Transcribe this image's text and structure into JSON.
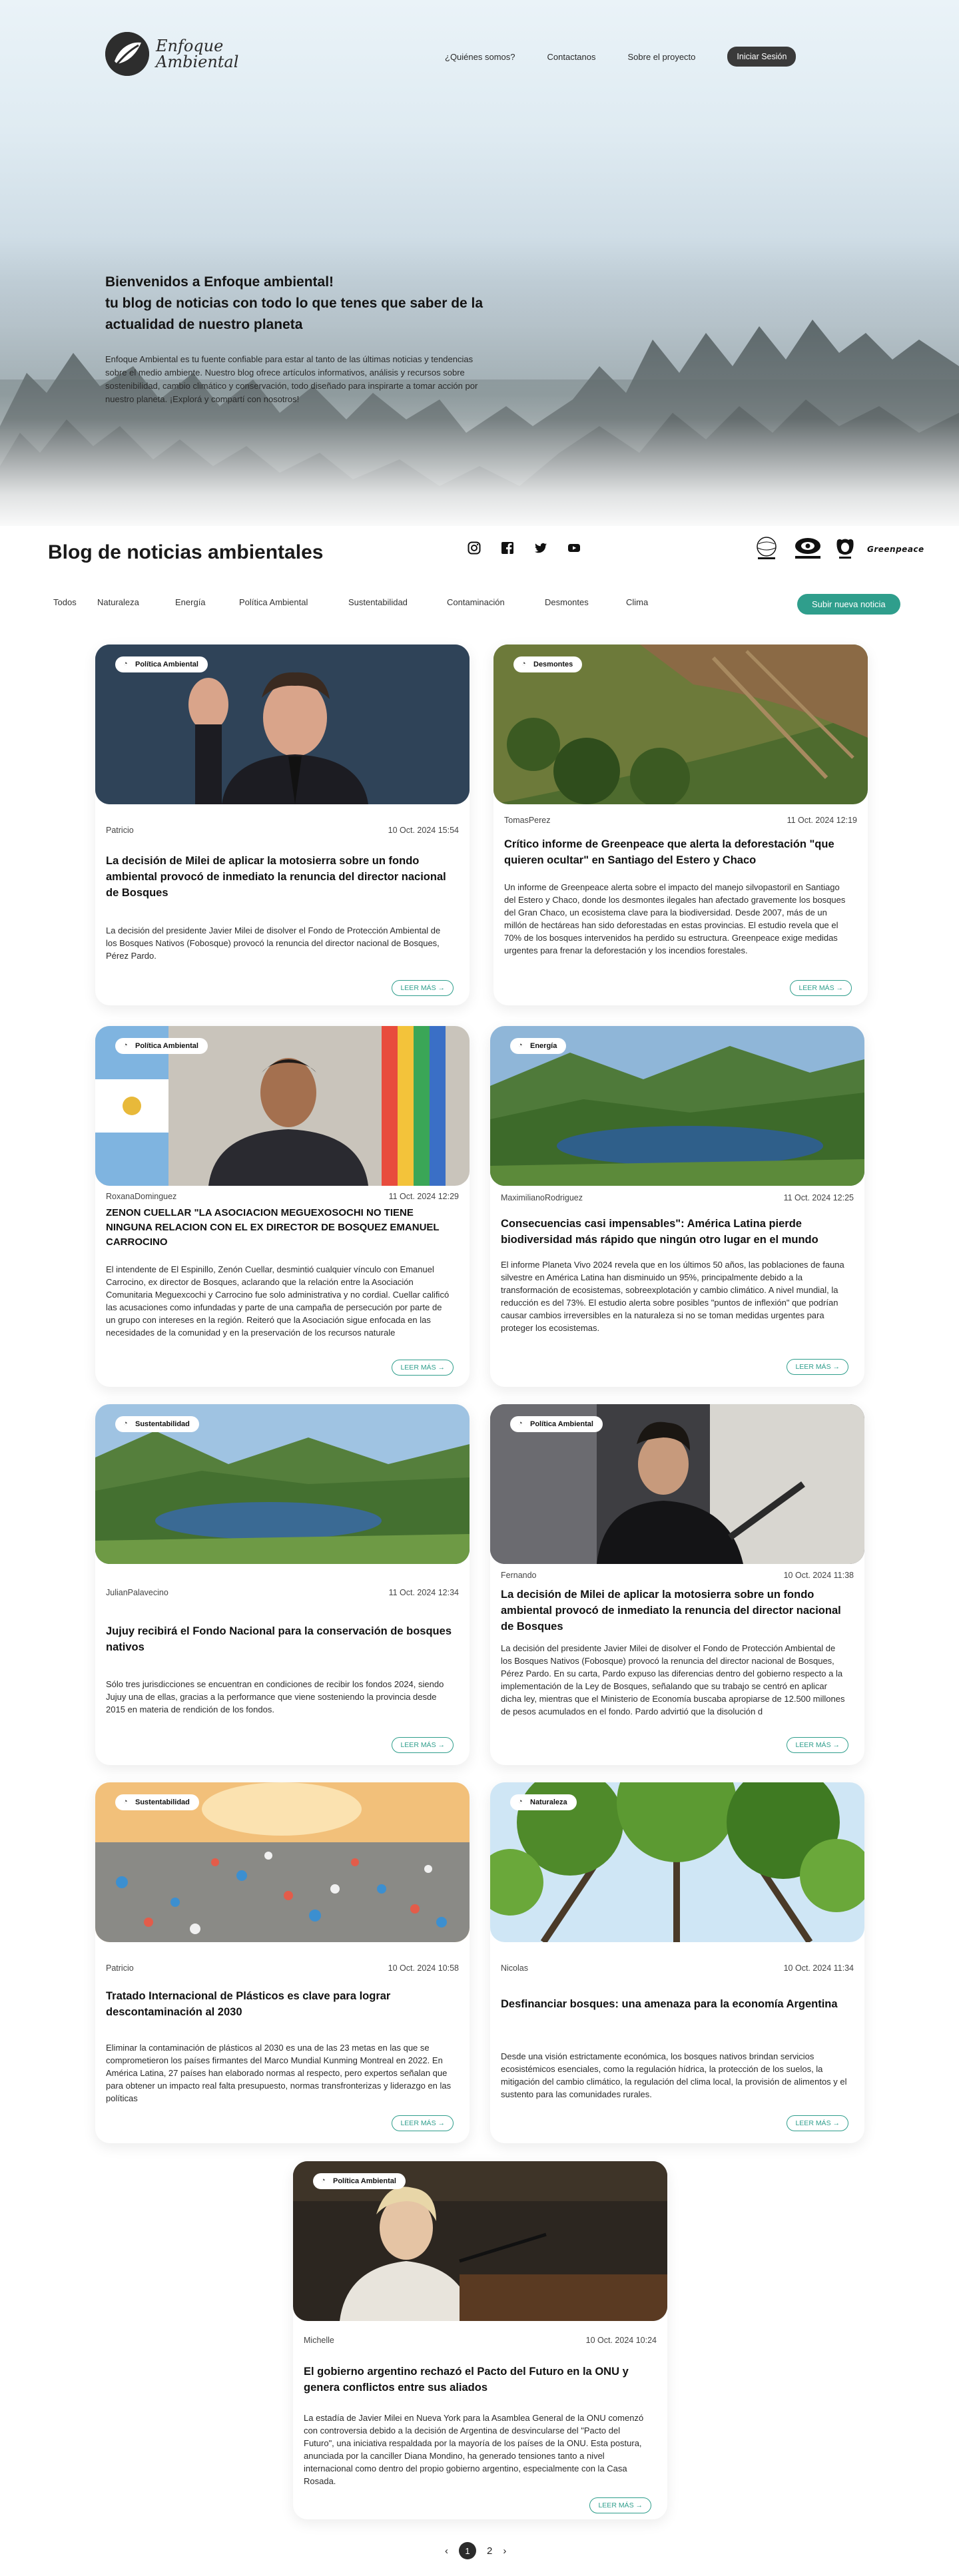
{
  "header": {
    "brand_line1": "Enfoque",
    "brand_line2": "Ambiental",
    "nav": [
      "¿Quiénes somos?",
      "Contactanos",
      "Sobre el proyecto"
    ],
    "login_label": "Iniciar Sesión"
  },
  "hero": {
    "title_line1": "Bienvenidos a Enfoque ambiental!",
    "title_line2": "tu blog de noticias con todo lo que tenes que saber de la actualidad de nuestro planeta",
    "description": "Enfoque Ambiental es tu fuente confiable para estar al tanto de las últimas noticias y tendencias sobre el medio ambiente. Nuestro blog ofrece artículos informativos, análisis y recursos sobre sostenibilidad, cambio climático y conservación, todo diseñado para inspirarte a tomar acción por nuestro planeta. ¡Explorá y compartí con nosotros!"
  },
  "blog": {
    "title": "Blog de noticias ambientales",
    "social_icons": [
      "instagram-icon",
      "facebook-icon",
      "twitter-icon",
      "youtube-icon"
    ],
    "partners": [
      "Fundación Vida Silvestre",
      "Greenpeace"
    ],
    "filters": [
      "Todos",
      "Naturaleza",
      "Energía",
      "Política Ambiental",
      "Sustentabilidad",
      "Contaminación",
      "Desmontes",
      "Clima"
    ],
    "submit_label": "Subir nueva noticia"
  },
  "colors": {
    "accent": "#2f9e8c",
    "dark": "#2b2b2b"
  },
  "posts": [
    {
      "category": "Política Ambiental",
      "author": "Patricio",
      "date": "10 Oct. 2024 15:54",
      "title": "La decisión de Milei de aplicar la motosierra sobre un fondo ambiental provocó de inmediato la renuncia del director nacional de Bosques",
      "body": "La decisión del presidente Javier Milei de disolver el Fondo de Protección Ambiental de los Bosques Nativos (Fobosque) provocó la renuncia del director nacional de Bosques, Pérez Pardo.",
      "more": "LEER MÁS →"
    },
    {
      "category": "Desmontes",
      "author": "TomasPerez",
      "date": "11 Oct. 2024 12:19",
      "title": "Crítico informe de Greenpeace que alerta la deforestación \"que quieren ocultar\" en Santiago del Estero y Chaco",
      "body": "Un informe de Greenpeace alerta sobre el impacto del manejo silvopastoril en Santiago del Estero y Chaco, donde los desmontes ilegales han afectado gravemente los bosques del Gran Chaco, un ecosistema clave para la biodiversidad. Desde 2007, más de un millón de hectáreas han sido deforestadas en estas provincias. El estudio revela que el 70% de los bosques intervenidos ha perdido su estructura. Greenpeace exige medidas urgentes para frenar la deforestación y los incendios forestales.",
      "more": "LEER MÁS →"
    },
    {
      "category": "Política Ambiental",
      "author": "RoxanaDominguez",
      "date": "11 Oct. 2024 12:29",
      "title": "ZENON CUELLAR \"LA ASOCIACION MEGUEXOSOCHI NO TIENE NINGUNA RELACION CON EL EX DIRECTOR DE BOSQUEZ EMANUEL CARROCINO",
      "body": "El intendente de El Espinillo, Zenón Cuellar, desmintió cualquier vínculo con Emanuel Carrocino, ex director de Bosques, aclarando que la relación entre la Asociación Comunitaria Meguexcochi y Carrocino fue solo administrativa y no cordial. Cuellar calificó las acusaciones como infundadas y parte de una campaña de persecución por parte de un grupo con intereses en la región. Reiteró que la Asociación sigue enfocada en las necesidades de la comunidad y en la preservación de los recursos naturale",
      "more": "LEER MÁS →"
    },
    {
      "category": "Energía",
      "author": "MaximilianoRodriguez",
      "date": "11 Oct. 2024 12:25",
      "title": "Consecuencias casi impensables\": América Latina pierde biodiversidad más rápido que ningún otro lugar en el mundo",
      "body": "El informe Planeta Vivo 2024 revela que en los últimos 50 años, las poblaciones de fauna silvestre en América Latina han disminuido un 95%, principalmente debido a la transformación de ecosistemas, sobreexplotación y cambio climático. A nivel mundial, la reducción es del 73%. El estudio alerta sobre posibles \"puntos de inflexión\" que podrían causar cambios irreversibles en la naturaleza si no se toman medidas urgentes para proteger los ecosistemas.",
      "more": "LEER MÁS →"
    },
    {
      "category": "Sustentabilidad",
      "author": "JulianPalavecino",
      "date": "11 Oct. 2024 12:34",
      "title": "Jujuy recibirá el Fondo Nacional para la conservación de bosques nativos",
      "body": "Sólo tres jurisdicciones se encuentran en condiciones de recibir los fondos 2024, siendo Jujuy una de ellas, gracias a la performance que viene sosteniendo la provincia desde 2015 en materia de rendición de los fondos.",
      "more": "LEER MÁS →"
    },
    {
      "category": "Política Ambiental",
      "author": "Fernando",
      "date": "10 Oct. 2024 11:38",
      "title": "La decisión de Milei de aplicar la motosierra sobre un fondo ambiental provocó de inmediato la renuncia del director nacional de Bosques",
      "body": "La decisión del presidente Javier Milei de disolver el Fondo de Protección Ambiental de los Bosques Nativos (Fobosque) provocó la renuncia del director nacional de Bosques, Pérez Pardo. En su carta, Pardo expuso las diferencias dentro del gobierno respecto a la implementación de la Ley de Bosques, señalando que su trabajo se centró en aplicar dicha ley, mientras que el Ministerio de Economía buscaba apropiarse de 12.500 millones de pesos acumulados en el fondo. Pardo advirtió que la disolución d",
      "more": "LEER MÁS →"
    },
    {
      "category": "Sustentabilidad",
      "author": "Patricio",
      "date": "10 Oct. 2024 10:58",
      "title": "Tratado Internacional de Plásticos es clave para lograr descontaminación al 2030",
      "body": "Eliminar la contaminación de plásticos al 2030 es una de las 23 metas en las que se comprometieron los países firmantes del Marco Mundial Kunming Montreal en 2022. En América Latina, 27 países han elaborado normas al respecto, pero expertos señalan que para obtener un impacto real falta presupuesto, normas transfronterizas y liderazgo en las políticas",
      "more": "LEER MÁS →"
    },
    {
      "category": "Naturaleza",
      "author": "Nicolas",
      "date": "10 Oct. 2024 11:34",
      "title": "Desfinanciar bosques: una amenaza para la economía Argentina",
      "body": "Desde una visión estrictamente económica, los bosques nativos brindan servicios ecosistémicos esenciales, como la regulación hídrica, la protección de los suelos, la mitigación del cambio climático, la regulación del clima local, la provisión de alimentos y el sustento para las comunidades rurales.",
      "more": "LEER MÁS →"
    },
    {
      "category": "Política Ambiental",
      "author": "Michelle",
      "date": "10 Oct. 2024 10:24",
      "title": "El gobierno argentino rechazó el Pacto del Futuro en la ONU y genera conflictos entre sus aliados",
      "body": "La estadía de Javier Milei en Nueva York para la Asamblea General de la ONU comenzó con controversia debido a la decisión de Argentina de desvincularse del \"Pacto del Futuro\", una iniciativa respaldada por la mayoría de los países de la ONU. Esta postura, anunciada por la canciller Diana Mondino, ha generado tensiones tanto a nivel internacional como dentro del propio gobierno argentino, especialmente con la Casa Rosada.",
      "more": "LEER MÁS →"
    }
  ],
  "pagination": {
    "prev": "‹",
    "current": "1",
    "next_page": "2",
    "next": "›"
  }
}
